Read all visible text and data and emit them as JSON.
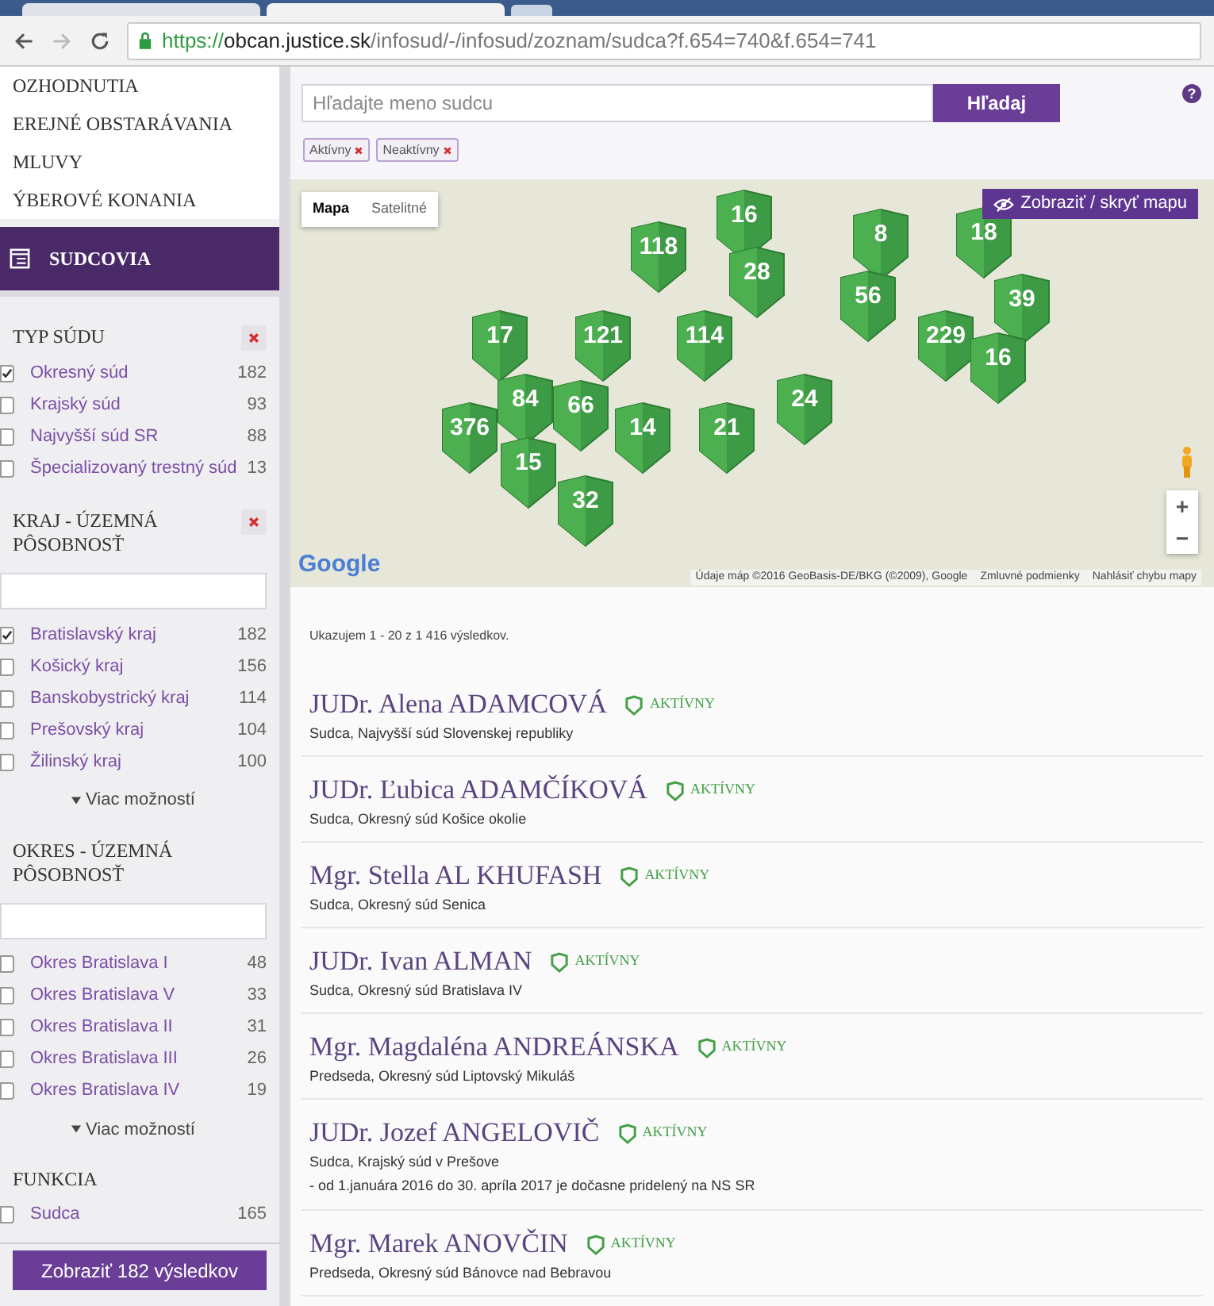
{
  "browser": {
    "url_scheme": "https://",
    "url_host": "obcan.justice.sk",
    "url_path": "/infosud/-/infosud/zoznam/sudca?f.654=740&f.654=741"
  },
  "top_menu": [
    "OZHODNUTIA",
    "EREJNÉ OBSTARÁVANIA",
    "MLUVY",
    "ÝBEROVÉ KONANIA"
  ],
  "section_header": "SUDCOVIA",
  "filters": [
    {
      "title": "TYP SÚDU",
      "clear_button": true,
      "search_field": false,
      "items": [
        {
          "label": "Okresný súd",
          "count": "182",
          "checked": true
        },
        {
          "label": "Krajský súd",
          "count": "93",
          "checked": false
        },
        {
          "label": "Najvyšší súd SR",
          "count": "88",
          "checked": false
        },
        {
          "label": "Špecializovaný trestný súd",
          "count": "13",
          "checked": false
        }
      ]
    },
    {
      "title": "KRAJ - ÚZEMNÁ PÔSOBNOSŤ",
      "clear_button": true,
      "search_field": true,
      "items": [
        {
          "label": "Bratislavský kraj",
          "count": "182",
          "checked": true
        },
        {
          "label": "Košický kraj",
          "count": "156",
          "checked": false
        },
        {
          "label": "Banskobystrický kraj",
          "count": "114",
          "checked": false
        },
        {
          "label": "Prešovský kraj",
          "count": "104",
          "checked": false
        },
        {
          "label": "Žilinský kraj",
          "count": "100",
          "checked": false
        }
      ],
      "more_link": "Viac možností"
    },
    {
      "title": "OKRES - ÚZEMNÁ PÔSOBNOSŤ",
      "clear_button": false,
      "search_field": true,
      "items": [
        {
          "label": "Okres Bratislava I",
          "count": "48",
          "checked": false
        },
        {
          "label": "Okres Bratislava V",
          "count": "33",
          "checked": false
        },
        {
          "label": "Okres Bratislava II",
          "count": "31",
          "checked": false
        },
        {
          "label": "Okres Bratislava III",
          "count": "26",
          "checked": false
        },
        {
          "label": "Okres Bratislava IV",
          "count": "19",
          "checked": false
        }
      ],
      "more_link": "Viac možností"
    },
    {
      "title": "FUNKCIA",
      "clear_button": false,
      "search_field": false,
      "items": [
        {
          "label": "Sudca",
          "count": "165",
          "checked": false
        }
      ]
    }
  ],
  "show_results_button": "Zobraziť 182 výsledkov",
  "search": {
    "placeholder": "Hľadajte meno sudcu",
    "button": "Hľadaj",
    "help": "?"
  },
  "active_tags": [
    "Aktívny",
    "Neaktívny"
  ],
  "map": {
    "view_tabs": [
      {
        "label": "Mapa",
        "selected": true
      },
      {
        "label": "Satelitné",
        "selected": false
      }
    ],
    "toggle_button": "Zobraziť / skryť mapu",
    "logo": "Google",
    "attribution": "Údaje máp ©2016 GeoBasis-DE/BKG (©2009), Google",
    "terms_link": "Zmluvné podmienky",
    "report_link": "Nahlásiť chybu mapy",
    "zoom_in": "+",
    "zoom_out": "−",
    "markers": [
      "16",
      "8",
      "18",
      "118",
      "28",
      "56",
      "39",
      "17",
      "121",
      "114",
      "229",
      "16",
      "84",
      "66",
      "24",
      "376",
      "14",
      "21",
      "15",
      "32"
    ]
  },
  "results_count": "Ukazujem 1 - 20 z 1 416 výsledkov.",
  "results": [
    {
      "name": "JUDr. Alena ADAMCOVÁ",
      "status": "AKTÍVNY",
      "active": true,
      "role": "Sudca, Najvyšší súd Slovenskej republiky"
    },
    {
      "name": "JUDr. Ľubica ADAMČÍKOVÁ",
      "status": "AKTÍVNY",
      "active": true,
      "role": "Sudca, Okresný súd Košice okolie"
    },
    {
      "name": "Mgr. Stella AL KHUFASH",
      "status": "AKTÍVNY",
      "active": true,
      "role": "Sudca, Okresný súd Senica"
    },
    {
      "name": "JUDr. Ivan ALMAN",
      "status": "AKTÍVNY",
      "active": true,
      "role": "Sudca, Okresný súd Bratislava IV"
    },
    {
      "name": "Mgr. Magdaléna ANDREÁNSKA",
      "status": "AKTÍVNY",
      "active": true,
      "role": "Predseda, Okresný súd Liptovský Mikuláš"
    },
    {
      "name": "JUDr. Jozef ANGELOVIČ",
      "status": "AKTÍVNY",
      "active": true,
      "role": "Sudca, Krajský súd v Prešove",
      "note": "- od 1.januára 2016 do 30. apríla 2017 je dočasne pridelený na NS SR"
    },
    {
      "name": "Mgr. Marek ANOVČIN",
      "status": "AKTÍVNY",
      "active": true,
      "role": "Predseda, Okresný súd Bánovce nad Bebravou"
    }
  ]
}
